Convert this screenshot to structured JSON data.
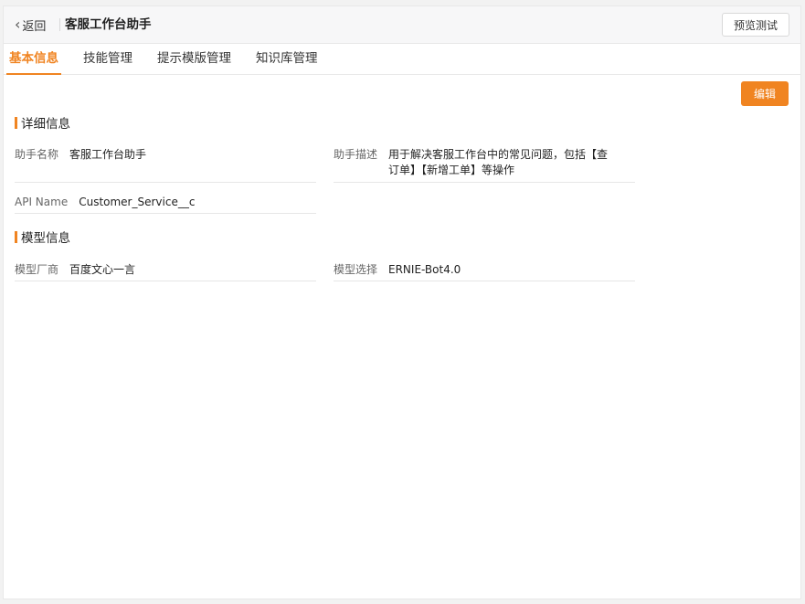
{
  "header": {
    "back_label": "返回",
    "back_icon": "chevron-left-icon",
    "title": "客服工作台助手",
    "preview_label": "预览测试"
  },
  "tabs": [
    {
      "label": "基本信息",
      "active": true
    },
    {
      "label": "技能管理",
      "active": false
    },
    {
      "label": "提示模版管理",
      "active": false
    },
    {
      "label": "知识库管理",
      "active": false
    }
  ],
  "actions": {
    "edit_label": "编辑"
  },
  "detail": {
    "title": "详细信息",
    "fields": {
      "name": {
        "label": "助手名称",
        "value": "客服工作台助手"
      },
      "description": {
        "label": "助手描述",
        "value": "用于解决客服工作台中的常见问题，包括【查订单】【新增工单】等操作"
      },
      "api_name": {
        "label": "API Name",
        "value": "Customer_Service__c"
      }
    }
  },
  "model": {
    "title": "模型信息",
    "fields": {
      "vendor": {
        "label": "模型厂商",
        "value": "百度文心一言"
      },
      "model": {
        "label": "模型选择",
        "value": "ERNIE-Bot4.0"
      }
    }
  },
  "colors": {
    "accent": "#f08421"
  }
}
